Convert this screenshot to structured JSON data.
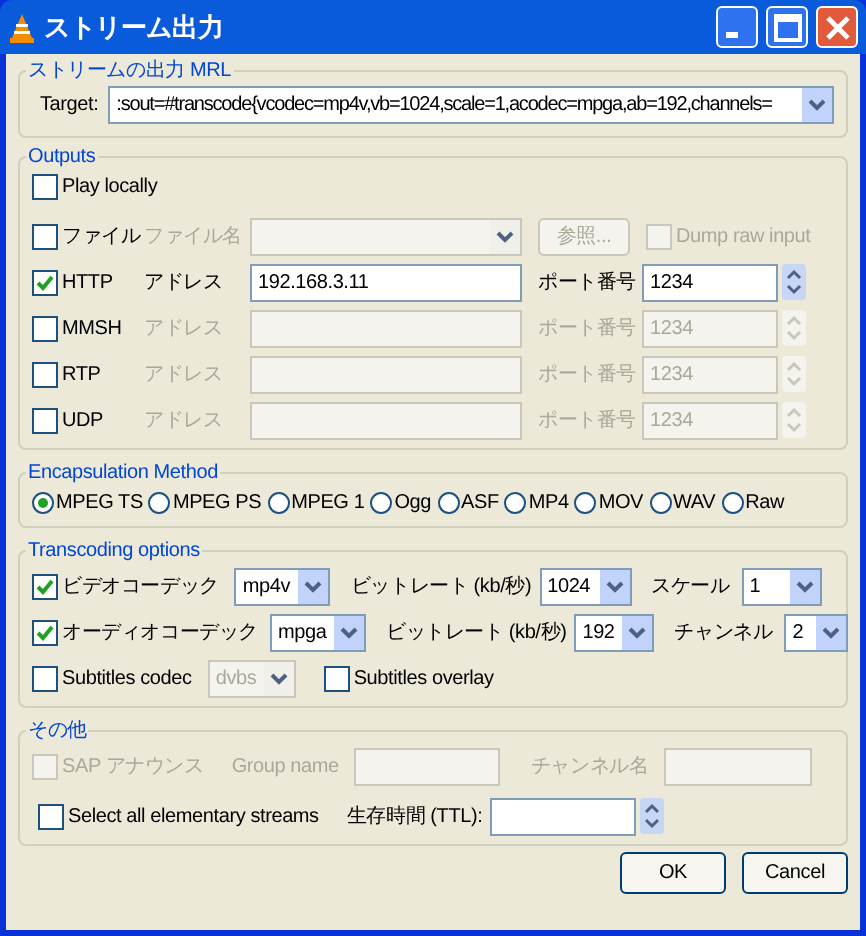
{
  "window": {
    "title": "ストリーム出力"
  },
  "mrl": {
    "legend": "ストリームの出力 MRL",
    "label": "Target:",
    "value": ":sout=#transcode{vcodec=mp4v,vb=1024,scale=1,acodec=mpga,ab=192,channels="
  },
  "outputs": {
    "legend": "Outputs",
    "play_locally": {
      "label": "Play locally",
      "checked": false
    },
    "rows": [
      {
        "kind": "file",
        "label": "ファイル",
        "checked": false,
        "field_label": "ファイル名",
        "browse": "参照...",
        "dump": {
          "label": "Dump raw input",
          "checked": false
        }
      },
      {
        "kind": "network",
        "label": "HTTP",
        "checked": true,
        "field_label": "アドレス",
        "value": "192.168.3.11",
        "port_label": "ポート番号",
        "port": "1234"
      },
      {
        "kind": "network",
        "label": "MMSH",
        "checked": false,
        "field_label": "アドレス",
        "port_label": "ポート番号",
        "port": "1234"
      },
      {
        "kind": "network",
        "label": "RTP",
        "checked": false,
        "field_label": "アドレス",
        "port_label": "ポート番号",
        "port": "1234"
      },
      {
        "kind": "network",
        "label": "UDP",
        "checked": false,
        "field_label": "アドレス",
        "port_label": "ポート番号",
        "port": "1234"
      }
    ]
  },
  "encapsulation": {
    "legend": "Encapsulation Method",
    "options": [
      {
        "label": "MPEG TS",
        "selected": true
      },
      {
        "label": "MPEG PS",
        "selected": false
      },
      {
        "label": "MPEG 1",
        "selected": false
      },
      {
        "label": "Ogg",
        "selected": false
      },
      {
        "label": "ASF",
        "selected": false
      },
      {
        "label": "MP4",
        "selected": false
      },
      {
        "label": "MOV",
        "selected": false
      },
      {
        "label": "WAV",
        "selected": false
      },
      {
        "label": "Raw",
        "selected": false
      }
    ]
  },
  "transcoding": {
    "legend": "Transcoding options",
    "video": {
      "label": "ビデオコーデック",
      "checked": true,
      "codec": "mp4v",
      "bitrate_label": "ビットレート (kb/秒)",
      "bitrate": "1024",
      "scale_label": "スケール",
      "scale": "1"
    },
    "audio": {
      "label": "オーディオコーデック",
      "checked": true,
      "codec": "mpga",
      "bitrate_label": "ビットレート (kb/秒)",
      "bitrate": "192",
      "channels_label": "チャンネル",
      "channels": "2"
    },
    "subtitles": {
      "label": "Subtitles codec",
      "checked": false,
      "codec": "dvbs",
      "overlay": {
        "label": "Subtitles overlay",
        "checked": false
      }
    }
  },
  "misc": {
    "legend": "その他",
    "sap": {
      "label": "SAP アナウンス",
      "checked": false,
      "disabled": true
    },
    "group_label": "Group name",
    "channel_label": "チャンネル名",
    "select_all": {
      "label": "Select all elementary streams",
      "checked": false
    },
    "ttl_label": "生存時間 (TTL):"
  },
  "buttons": [
    {
      "label": "OK"
    },
    {
      "label": "Cancel"
    }
  ]
}
